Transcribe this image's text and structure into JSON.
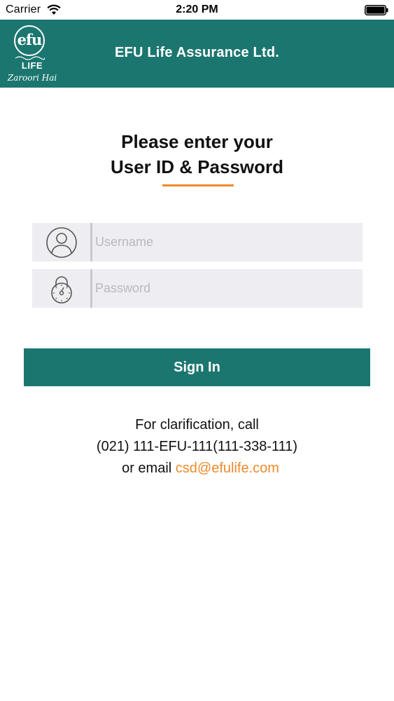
{
  "status_bar": {
    "carrier": "Carrier",
    "time": "2:20 PM"
  },
  "header": {
    "title": "EFU Life Assurance Ltd.",
    "logo": {
      "efu": "efu",
      "life": "LIFE",
      "tagline": "Zaroori Hai"
    }
  },
  "login": {
    "headline_line1": "Please enter your",
    "headline_line2": "User ID & Password",
    "username_placeholder": "Username",
    "password_placeholder": "Password",
    "signin_label": "Sign In"
  },
  "contact": {
    "line1": "For clarification, call",
    "phone": "(021) 111-EFU-111(111-338-111)",
    "email_prefix": "or email",
    "email": "csd@efulife.com"
  },
  "colors": {
    "brand_teal": "#1c7670",
    "accent_orange": "#ee8a2a",
    "field_background": "#eeeef2"
  },
  "icons": [
    "wifi-icon",
    "battery-icon",
    "user-icon",
    "lock-icon"
  ]
}
